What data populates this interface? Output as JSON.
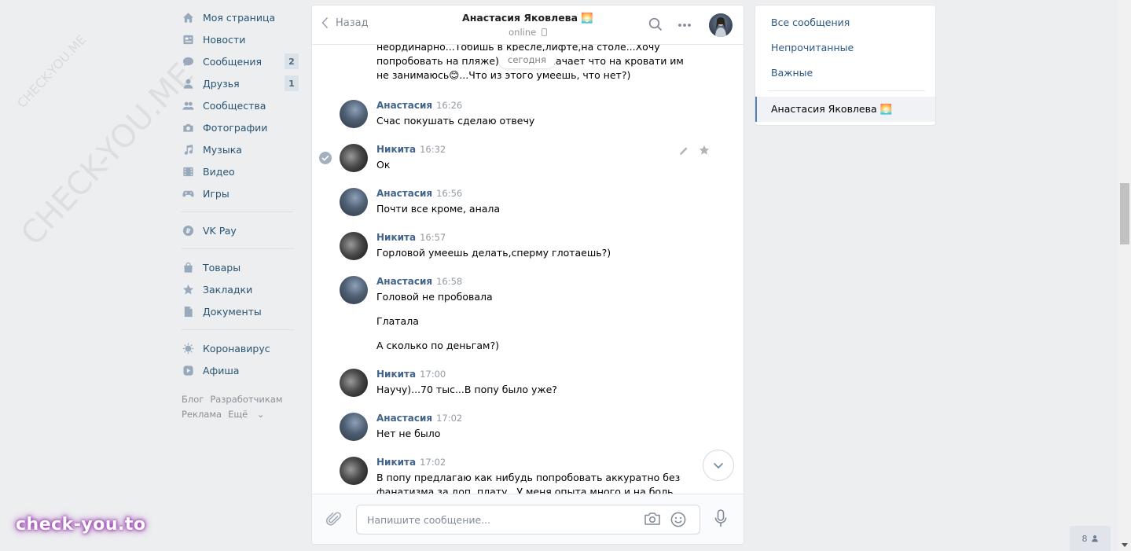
{
  "nav": {
    "items": [
      {
        "label": "Моя страница",
        "icon": "home-icon"
      },
      {
        "label": "Новости",
        "icon": "news-icon"
      },
      {
        "label": "Сообщения",
        "icon": "message-icon",
        "count": "2"
      },
      {
        "label": "Друзья",
        "icon": "friends-icon",
        "count": "1"
      },
      {
        "label": "Сообщества",
        "icon": "groups-icon"
      },
      {
        "label": "Фотографии",
        "icon": "camera-icon"
      },
      {
        "label": "Музыка",
        "icon": "music-icon"
      },
      {
        "label": "Видео",
        "icon": "video-icon"
      },
      {
        "label": "Игры",
        "icon": "gamepad-icon"
      }
    ],
    "vkpay": {
      "label": "VK Pay",
      "icon": "vkpay-icon"
    },
    "items2": [
      {
        "label": "Товары",
        "icon": "bag-icon"
      },
      {
        "label": "Закладки",
        "icon": "star-icon"
      },
      {
        "label": "Документы",
        "icon": "document-icon"
      }
    ],
    "items3": [
      {
        "label": "Коронавирус",
        "icon": "virus-icon"
      },
      {
        "label": "Афиша",
        "icon": "play-icon"
      }
    ],
    "footer": {
      "blog": "Блог",
      "developers": "Разработчикам",
      "ads": "Реклама",
      "more": "Ещё"
    }
  },
  "chat": {
    "back_label": "Назад",
    "title": "Анастасия Яковлева 🌅",
    "status": "online",
    "date_pill": "сегодня",
    "partial_message": [
      "неординарно...Тобишь в кресле,лифте,на столе...Хочу",
      "попробовать на пляже)...Иногда начает что на кровати им",
      "не занимаюсь😊...Что из этого умеешь, что нет?)"
    ],
    "messages": [
      {
        "author": "Анастасия",
        "time": "16:26",
        "texts": [
          "Счас покушать сделаю отвечу"
        ]
      },
      {
        "author": "Никита",
        "time": "16:32",
        "texts": [
          "Ок"
        ]
      },
      {
        "author": "Анастасия",
        "time": "16:56",
        "texts": [
          "Почти все кроме, анала"
        ]
      },
      {
        "author": "Никита",
        "time": "16:57",
        "texts": [
          "Горловой умеешь делать,сперму глотаешь?)"
        ]
      },
      {
        "author": "Анастасия",
        "time": "16:58",
        "texts": [
          "Головой не пробовала",
          "Глатала",
          "А сколько по деньгам?)"
        ]
      },
      {
        "author": "Никита",
        "time": "17:00",
        "texts": [
          "Научу)...70 тыс...В попу было уже?"
        ]
      },
      {
        "author": "Анастасия",
        "time": "17:02",
        "texts": [
          "Нет не было"
        ]
      },
      {
        "author": "Никита",
        "time": "17:02",
        "texts": [
          "В попу предлагаю как нибудь попробовать аккуратно без фанатизма за доп. плату...У меня опыта много и на боль никто"
        ]
      }
    ],
    "composer_placeholder": "Напишите сообщение..."
  },
  "right_panel": {
    "all": "Все сообщения",
    "unread": "Непрочитанные",
    "important": "Важные",
    "active_chat": "Анастасия Яковлева 🌅"
  },
  "online_count": "8",
  "watermarks": {
    "big": "CHECK-YOU.ME",
    "small": "CHECK-YOU.ME",
    "logo": "check-you.to"
  },
  "colors": {
    "accent": "#5181b8",
    "link": "#2a5885",
    "author": "#42648b",
    "background": "#edeef0"
  }
}
